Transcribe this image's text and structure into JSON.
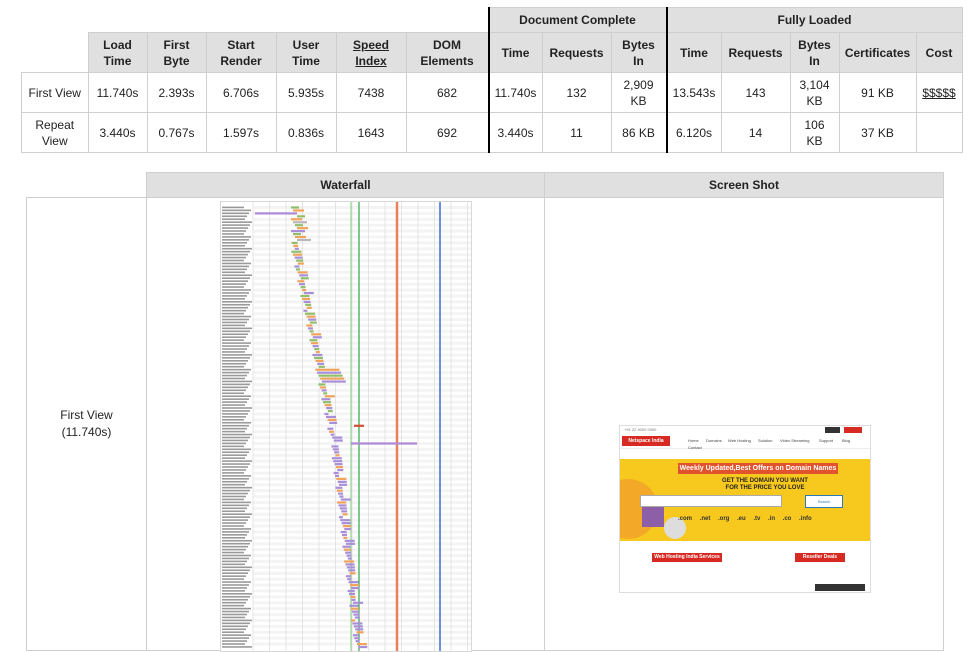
{
  "summary": {
    "groups": {
      "document_complete": "Document Complete",
      "fully_loaded": "Fully Loaded"
    },
    "headers": {
      "load_time": [
        "Load",
        "Time"
      ],
      "first_byte": [
        "First",
        "Byte"
      ],
      "start_render": [
        "Start",
        "Render"
      ],
      "user_time": [
        "User",
        "Time"
      ],
      "speed_index": [
        "Speed",
        "Index"
      ],
      "dom_elements": [
        "DOM",
        "Elements"
      ],
      "dc_time": "Time",
      "dc_requests": "Requests",
      "dc_bytes_in": [
        "Bytes",
        "In"
      ],
      "fl_time": "Time",
      "fl_requests": "Requests",
      "fl_bytes_in": [
        "Bytes",
        "In"
      ],
      "certificates": "Certificates",
      "cost": "Cost"
    },
    "rows": [
      {
        "label": "First View",
        "load_time": "11.740s",
        "first_byte": "2.393s",
        "start_render": "6.706s",
        "user_time": "5.935s",
        "speed_index": "7438",
        "dom_elements": "682",
        "dc_time": "11.740s",
        "dc_requests": "132",
        "dc_bytes_in": [
          "2,909",
          "KB"
        ],
        "fl_time": "13.543s",
        "fl_requests": "143",
        "fl_bytes_in": [
          "3,104",
          "KB"
        ],
        "certificates": "91 KB",
        "cost": "$$$$$"
      },
      {
        "label": [
          "Repeat",
          "View"
        ],
        "load_time": "3.440s",
        "first_byte": "0.767s",
        "start_render": "1.597s",
        "user_time": "0.836s",
        "speed_index": "1643",
        "dom_elements": "692",
        "dc_time": "3.440s",
        "dc_requests": "11",
        "dc_bytes_in": "86 KB",
        "fl_time": "6.120s",
        "fl_requests": "14",
        "fl_bytes_in": [
          "106",
          "KB"
        ],
        "certificates": "37 KB",
        "cost": ""
      }
    ]
  },
  "details": {
    "headers": {
      "waterfall": "Waterfall",
      "screenshot": "Screen Shot"
    },
    "view_label": "First View",
    "view_time": "(11.740s)"
  },
  "screenshot_thumb": {
    "phone": "+91 22 4000 0000",
    "logo": "Netspace India",
    "nav": [
      "Home",
      "Domains",
      "Web Hosting",
      "Solution",
      "Video Streaming",
      "Support",
      "Blog"
    ],
    "nav_sub": "Contact",
    "banner_title": "Weekly Updated,Best Offers on Domain Names",
    "banner_sub": [
      "GET THE DOMAIN YOU WANT",
      "FOR THE PRICE YOU LOVE"
    ],
    "search_button": "Search",
    "tlds": ".com .net .org .eu .tv .in .co .info",
    "button_hosting": "Web Hosting India Services",
    "button_other": "Reseller Deals"
  },
  "colors": {
    "header_bg": "#e0e0e0",
    "start_render_line": "#28a745",
    "doc_complete_line": "#3b6ccf",
    "onload_line": "#e8805b"
  }
}
